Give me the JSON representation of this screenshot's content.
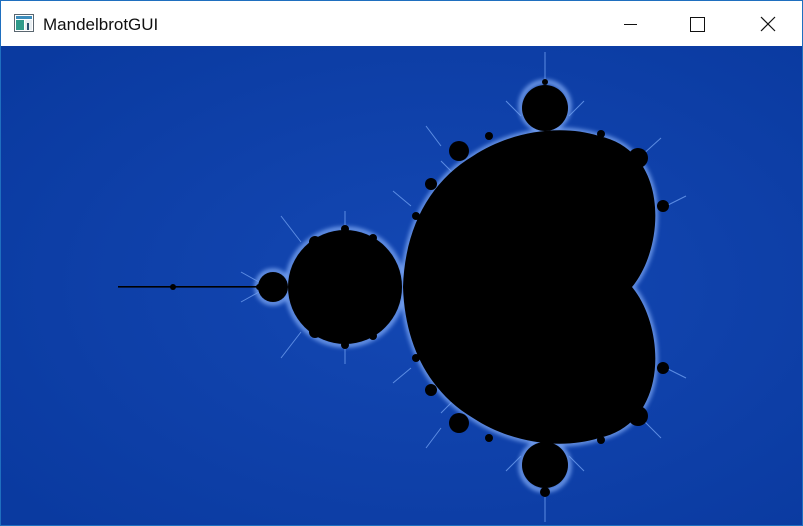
{
  "window": {
    "title": "MandelbrotGUI",
    "app_icon": "app-window-icon",
    "controls": {
      "minimize_icon": "minimize-icon",
      "maximize_icon": "maximize-icon",
      "close_icon": "close-icon"
    }
  },
  "canvas": {
    "content": "mandelbrot-fractal",
    "colors": {
      "background": "#0a3aa0",
      "set": "#000000",
      "fringe": "#8fb8ff",
      "fringe_outer": "#4f86ea"
    }
  }
}
